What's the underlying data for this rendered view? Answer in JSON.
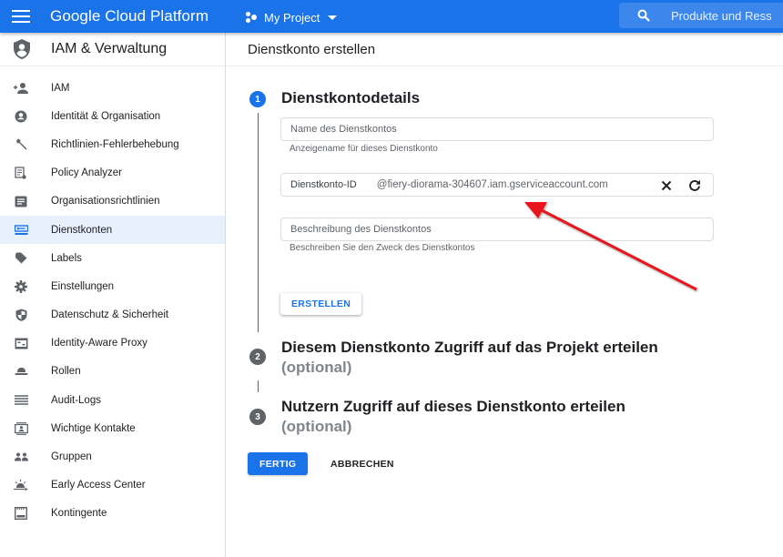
{
  "topbar": {
    "brand": "Google Cloud Platform",
    "project": "My Project",
    "search_placeholder": "Produkte und Ress"
  },
  "sidebar": {
    "title": "IAM & Verwaltung",
    "items": [
      {
        "label": "IAM",
        "icon": "person-add-icon"
      },
      {
        "label": "Identität & Organisation",
        "icon": "account-circle-icon"
      },
      {
        "label": "Richtlinien-Fehlerbehebung",
        "icon": "wrench-icon"
      },
      {
        "label": "Policy Analyzer",
        "icon": "policy-analyzer-icon"
      },
      {
        "label": "Organisationsrichtlinien",
        "icon": "list-alt-icon"
      },
      {
        "label": "Dienstkonten",
        "icon": "service-account-icon",
        "active": true
      },
      {
        "label": "Labels",
        "icon": "label-tag-icon"
      },
      {
        "label": "Einstellungen",
        "icon": "gear-icon"
      },
      {
        "label": "Datenschutz & Sicherheit",
        "icon": "shield-icon"
      },
      {
        "label": "Identity-Aware Proxy",
        "icon": "proxy-icon"
      },
      {
        "label": "Rollen",
        "icon": "hat-icon"
      },
      {
        "label": "Audit-Logs",
        "icon": "lines-icon"
      },
      {
        "label": "Wichtige Kontakte",
        "icon": "contact-card-icon"
      },
      {
        "label": "Gruppen",
        "icon": "group-icon"
      },
      {
        "label": "Early Access Center",
        "icon": "sunrise-icon"
      },
      {
        "label": "Kontingente",
        "icon": "quota-icon"
      }
    ]
  },
  "main": {
    "page_title": "Dienstkonto erstellen",
    "step1": {
      "number": "1",
      "title": "Dienstkontodetails",
      "name_field_placeholder": "Name des Dienstkontos",
      "name_field_hint": "Anzeigename für dieses Dienstkonto",
      "id_field_label": "Dienstkonto-ID",
      "id_field_suffix": "@fiery-diorama-304607.iam.gserviceaccount.com",
      "desc_field_placeholder": "Beschreibung des Dienstkontos",
      "desc_field_hint": "Beschreiben Sie den Zweck des Dienstkontos",
      "create_button": "ERSTELLEN"
    },
    "step2": {
      "number": "2",
      "title": "Diesem Dienstkonto Zugriff auf das Projekt erteilen",
      "optional": "(optional)"
    },
    "step3": {
      "number": "3",
      "title": "Nutzern Zugriff auf dieses Dienstkonto erteilen",
      "optional": "(optional)"
    },
    "done_button": "FERTIG",
    "cancel_button": "ABBRECHEN"
  },
  "colors": {
    "brand_blue": "#1a73e8",
    "active_bg": "#e8f0fe",
    "step_inactive": "#5f6368",
    "annotation_arrow": "#e8141b"
  }
}
